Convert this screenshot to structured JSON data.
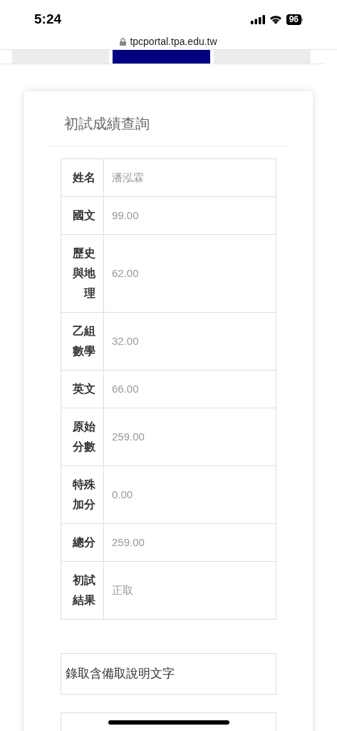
{
  "status_bar": {
    "time": "5:24",
    "battery": "96"
  },
  "address_bar": {
    "url": "tpcportal.tpa.edu.tw"
  },
  "tabs": [
    {
      "selected": false
    },
    {
      "selected": true
    },
    {
      "selected": false
    }
  ],
  "card": {
    "title": "初試成績查詢",
    "rows": [
      {
        "label": "姓名",
        "value": "潘泓霖"
      },
      {
        "label": "國文",
        "value": "99.00"
      },
      {
        "label": "歷史與地理",
        "value": "62.00"
      },
      {
        "label": "乙組數學",
        "value": "32.00"
      },
      {
        "label": "英文",
        "value": "66.00"
      },
      {
        "label": "原始分數",
        "value": "259.00"
      },
      {
        "label": "特殊加分",
        "value": "0.00"
      },
      {
        "label": "總分",
        "value": "259.00"
      },
      {
        "label": "初試結果",
        "value": "正取"
      }
    ],
    "note": "錄取含備取說明文字"
  }
}
